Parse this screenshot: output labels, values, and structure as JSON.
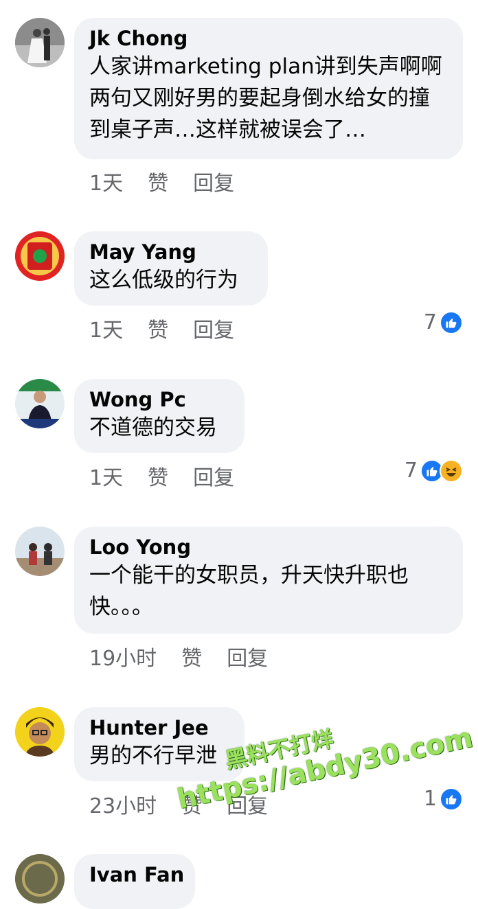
{
  "comments": [
    {
      "name": "Jk Chong",
      "text": "人家讲marketing plan讲到失声啊啊两句又刚好男的要起身倒水给女的撞到桌子声…这样就被误会了…",
      "time": "1天",
      "like": "赞",
      "reply": "回复",
      "reactions": ""
    },
    {
      "name": "May Yang",
      "text": "这么低级的行为",
      "time": "1天",
      "like": "赞",
      "reply": "回复",
      "reactions": "7"
    },
    {
      "name": "Wong Pc",
      "text": "不道德的交易",
      "time": "1天",
      "like": "赞",
      "reply": "回复",
      "reactions": "7"
    },
    {
      "name": "Loo Yong",
      "text": "一个能干的女职员，升天快升职也快。。。",
      "time": "19小时",
      "like": "赞",
      "reply": "回复",
      "reactions": ""
    },
    {
      "name": "Hunter Jee",
      "text": "男的不行早泄",
      "time": "23小时",
      "like": "赞",
      "reply": "回复",
      "reactions": "1"
    },
    {
      "name": "Ivan Fan",
      "text": "",
      "time": "",
      "like": "",
      "reply": "",
      "reactions": ""
    }
  ],
  "watermark": {
    "line1": "黑料不打烊",
    "line2": "https://abdy30.com"
  },
  "colors": {
    "like_blue": "#1877f2",
    "bubble_gray": "#f0f2f5",
    "meta_gray": "#65676b"
  }
}
